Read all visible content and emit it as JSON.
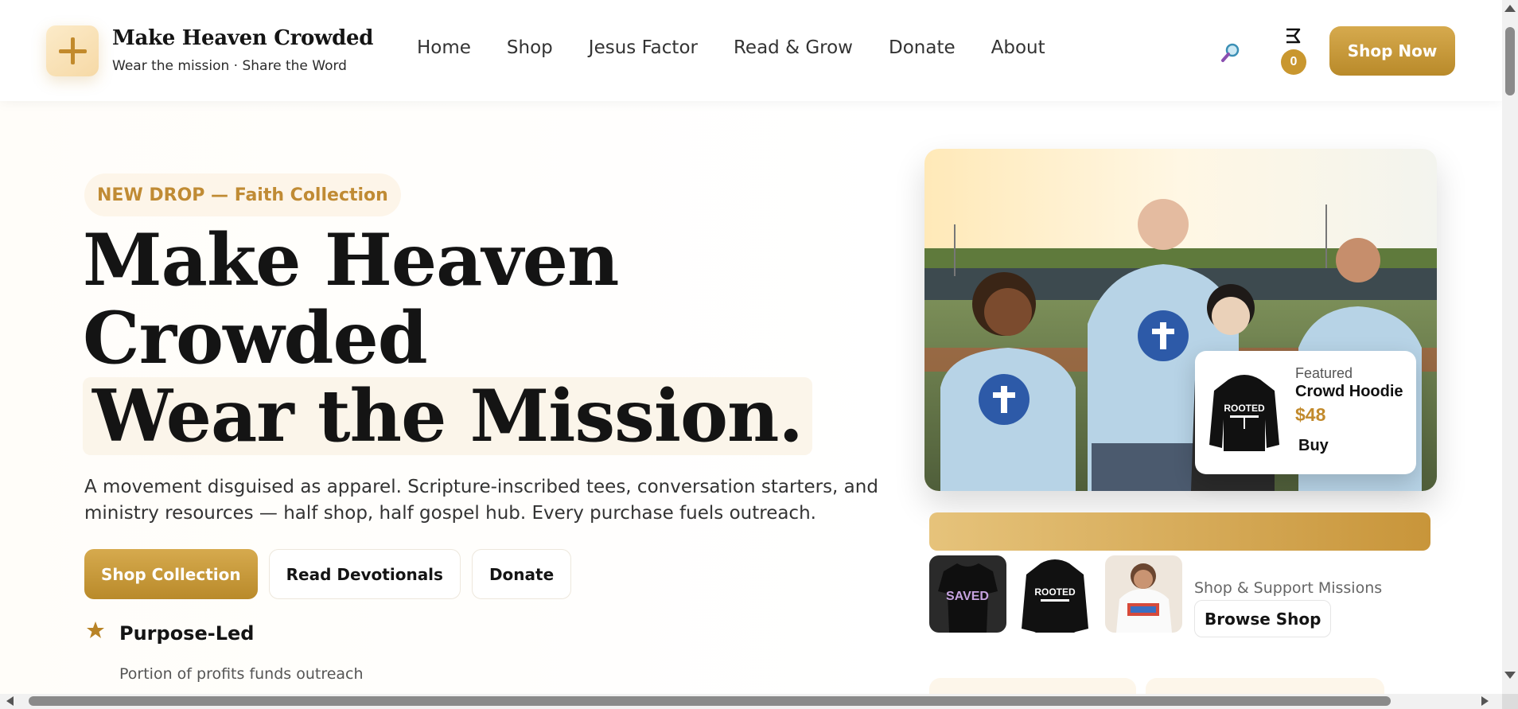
{
  "header": {
    "brand_name": "Make Heaven Crowded",
    "brand_tagline": "Wear the mission · Share the Word",
    "nav": [
      "Home",
      "Shop",
      "Jesus Factor",
      "Read & Grow",
      "Donate",
      "About"
    ],
    "cart_count": "0",
    "shop_now_label": "Shop Now"
  },
  "hero": {
    "pill": "NEW DROP — Faith Collection",
    "title_line1": "Make Heaven",
    "title_line2": "Crowded",
    "title_line3": "Wear the Mission.",
    "description_line1": "A movement disguised as apparel. Scripture-inscribed tees, conversation starters, and",
    "description_line2": "ministry resources — half shop, half gospel hub. Every purchase fuels outreach.",
    "buttons": {
      "shop_collection": "Shop Collection",
      "read_devotionals": "Read Devotionals",
      "donate": "Donate"
    },
    "feature": {
      "title": "Purpose-Led",
      "description": "Portion of profits funds outreach"
    }
  },
  "featured": {
    "label": "Featured",
    "name": "Crowd Hoodie",
    "price": "$48",
    "buy_label": "Buy",
    "hoodie_print": "ROOTED"
  },
  "shop_strip": {
    "support_label": "Shop & Support Missions",
    "browse_label": "Browse Shop",
    "thumb_prints": [
      "SAVED",
      "ROOTED"
    ]
  },
  "colors": {
    "accent": "#c9972f",
    "accent_dark": "#b98a2a",
    "pill_bg": "#fdf5e9",
    "title_text": "#141414"
  }
}
